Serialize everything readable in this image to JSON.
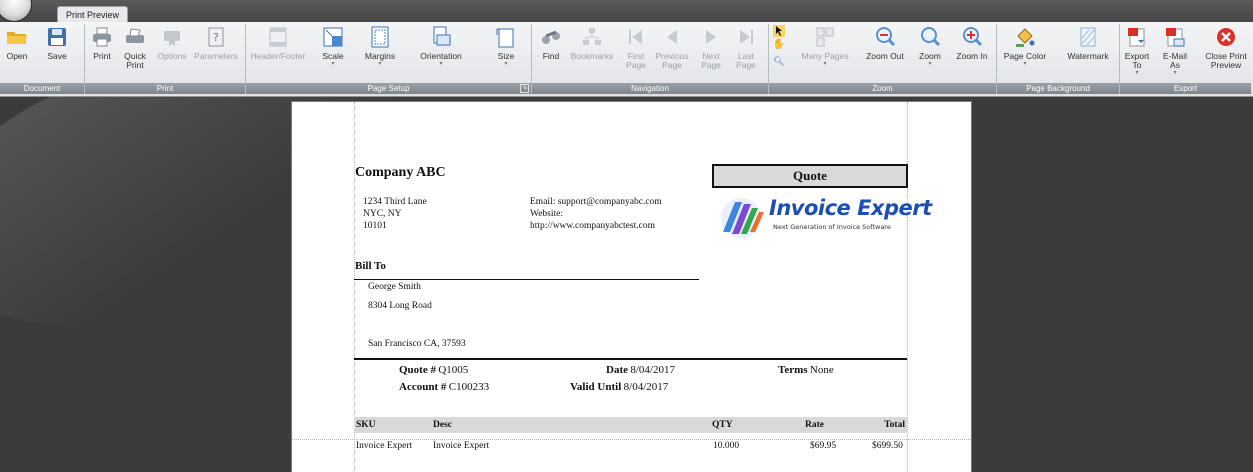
{
  "tab": "Print Preview",
  "ribbon": {
    "document": {
      "label": "Document",
      "open": "Open",
      "save": "Save"
    },
    "print": {
      "label": "Print",
      "print": "Print",
      "quick_print": "Quick Print",
      "options": "Options",
      "parameters": "Parameters"
    },
    "page_setup": {
      "label": "Page Setup",
      "header_footer": "Header/Footer",
      "scale": "Scale",
      "margins": "Margins",
      "orientation": "Orientation",
      "size": "Size"
    },
    "navigation": {
      "label": "Navigation",
      "find": "Find",
      "bookmarks": "Bookmarks",
      "first_page": "First Page",
      "previous_page": "Previous Page",
      "next_page": "Next Page",
      "last_page": "Last Page"
    },
    "zoom": {
      "label": "Zoom",
      "many_pages": "Many Pages",
      "zoom_out": "Zoom Out",
      "zoom": "Zoom",
      "zoom_in": "Zoom In"
    },
    "page_background": {
      "label": "Page Background",
      "page_color": "Page Color",
      "watermark": "Watermark"
    },
    "export": {
      "label": "Export",
      "export_to": "Export To",
      "email_as": "E-Mail As",
      "close": "Close Print Preview"
    }
  },
  "doc": {
    "company": "Company ABC",
    "addr1": "1234 Third Lane",
    "addr2": "NYC, NY",
    "addr3": "10101",
    "email": "Email: support@companyabc.com",
    "website_label": "Website:",
    "website": "http://www.companyabctest.com",
    "quote_title": "Quote",
    "logo_title": "Invoice Expert",
    "logo_sub": "Next Generation of Invoice Software",
    "bill_to": "Bill To",
    "bill_name": "George Smith",
    "bill_addr": "8304 Long Road",
    "bill_city": "San Francisco CA, 37593",
    "quote_no_label": "Quote #",
    "quote_no": "Q1005",
    "account_label": "Account #",
    "account": "C100233",
    "date_label": "Date",
    "date": "8/04/2017",
    "valid_label": "Valid Until",
    "valid": "8/04/2017",
    "terms_label": "Terms",
    "terms": "None",
    "columns": {
      "sku": "SKU",
      "desc": "Desc",
      "qty": "QTY",
      "rate": "Rate",
      "total": "Total"
    },
    "rows": [
      {
        "sku": "Invoice Expert",
        "desc": "Invoice Expert",
        "qty": "10.000",
        "rate": "$69.95",
        "total": "$699.50"
      }
    ]
  },
  "colors": {
    "accent": "#1b4fb5",
    "ribbon_label": "#7f858d",
    "close_red": "#d9302a"
  }
}
